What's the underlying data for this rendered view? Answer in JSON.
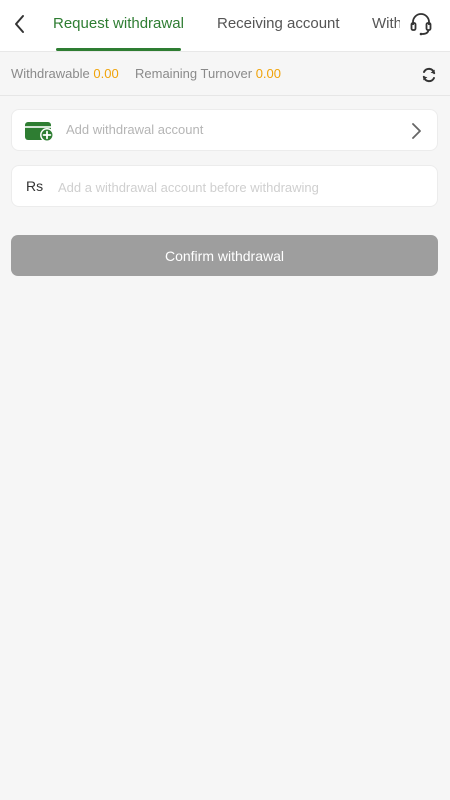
{
  "header": {
    "tabs": [
      {
        "label": "Request withdrawal",
        "active": true
      },
      {
        "label": "Receiving account",
        "active": false
      },
      {
        "label": "Withdrawal records",
        "active": false
      }
    ]
  },
  "stats": {
    "withdrawable_label": "Withdrawable",
    "withdrawable_value": "0.00",
    "turnover_label": "Remaining Turnover",
    "turnover_value": "0.00"
  },
  "account": {
    "add_label": "Add withdrawal account"
  },
  "amount": {
    "currency": "Rs",
    "placeholder": "Add a withdrawal account before withdrawing",
    "value": ""
  },
  "confirm_label": "Confirm withdrawal",
  "colors": {
    "accent_green": "#2e7d32",
    "value_orange": "#f0a30a",
    "button_disabled": "#9e9e9e",
    "background": "#f6f6f6"
  },
  "icons": {
    "back": "chevron-left-icon",
    "support": "headset-icon",
    "refresh": "refresh-icon",
    "wallet": "wallet-add-icon",
    "chevron": "chevron-right-icon"
  }
}
